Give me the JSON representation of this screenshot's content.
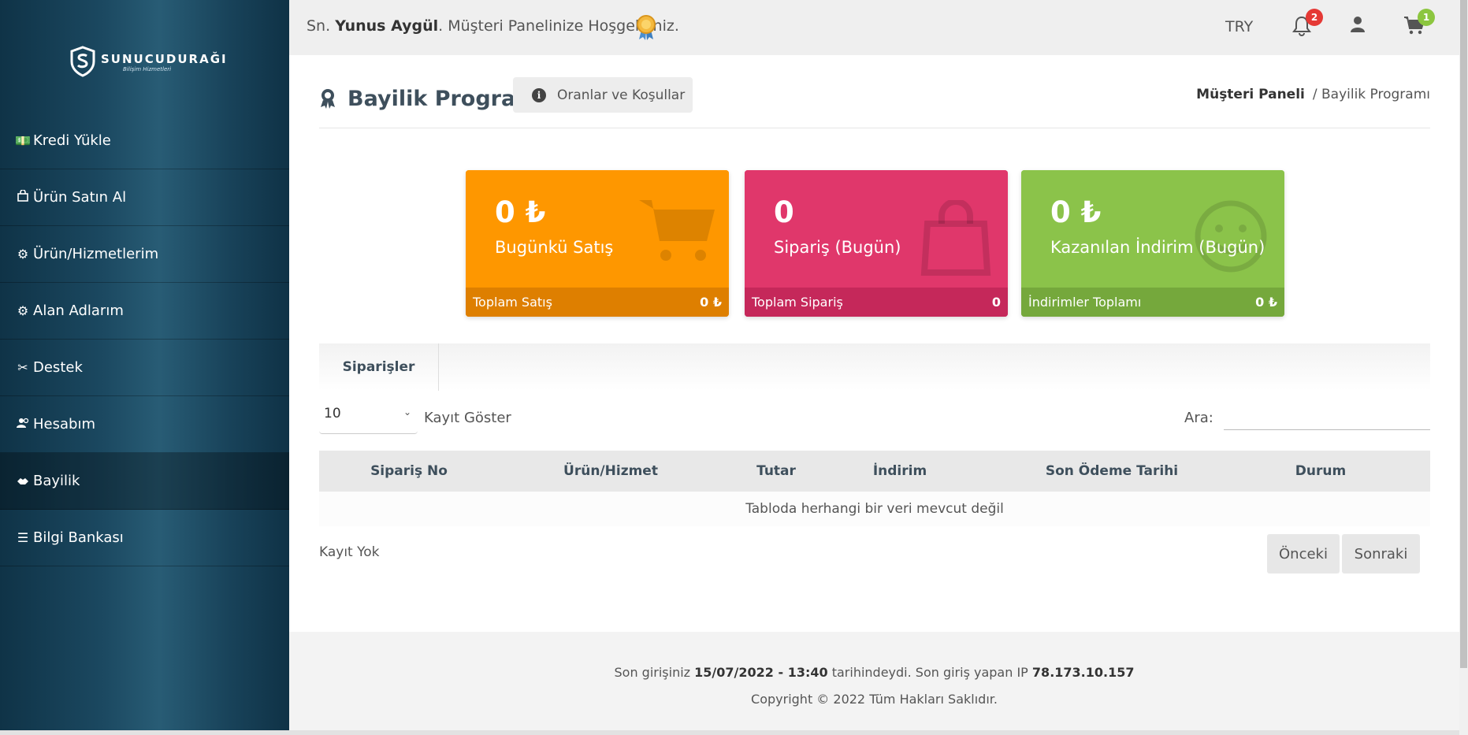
{
  "brand": {
    "name": "SUNUCUDURAĞI",
    "tagline": "Bilişim Hizmetleri"
  },
  "sidebar": {
    "items": [
      {
        "label": "Kredi Yükle",
        "icon": "money-icon"
      },
      {
        "label": "Ürün Satın Al",
        "icon": "shopping-bag-icon"
      },
      {
        "label": "Ürün/Hizmetlerim",
        "icon": "gear-icon"
      },
      {
        "label": "Alan Adlarım",
        "icon": "gear-icon"
      },
      {
        "label": "Destek",
        "icon": "tools-icon"
      },
      {
        "label": "Hesabım",
        "icon": "users-icon"
      },
      {
        "label": "Bayilik",
        "icon": "handshake-icon",
        "active": true
      },
      {
        "label": "Bilgi Bankası",
        "icon": "list-icon"
      }
    ]
  },
  "topbar": {
    "prefix": "Sn. ",
    "user_name": "Yunus Aygül",
    "welcome_suffix": ". Müşteri Panelinize Hoşgeldiniz.",
    "currency": "TRY",
    "notifications_count": "2",
    "cart_count": "1"
  },
  "page": {
    "title": "Bayilik Programı",
    "rates_button": "Oranlar ve Koşullar",
    "breadcrumb_home": "Müşteri Paneli",
    "breadcrumb_current": "/ Bayilik Programı"
  },
  "cards": [
    {
      "value": "0 ₺",
      "label": "Bugünkü Satış",
      "foot_label": "Toplam Satış",
      "foot_value": "0 ₺",
      "color": "#fe9700",
      "foot_color": "#de7f00"
    },
    {
      "value": "0",
      "label": "Sipariş (Bugün)",
      "foot_label": "Toplam Sipariş",
      "foot_value": "0",
      "color": "#e0376b",
      "foot_color": "#c5285a"
    },
    {
      "value": "0 ₺",
      "label": "Kazanılan İndirim (Bugün)",
      "foot_label": "İndirimler Toplamı",
      "foot_value": "0 ₺",
      "color": "#8bc34a",
      "foot_color": "#75a83c"
    }
  ],
  "tabs": [
    "Siparişler"
  ],
  "table": {
    "length_value": "10",
    "length_label": "Kayıt Göster",
    "search_label": "Ara:",
    "columns": [
      "Sipariş No",
      "Ürün/Hizmet",
      "Tutar",
      "İndirim",
      "Son Ödeme Tarihi",
      "Durum"
    ],
    "empty_message": "Tabloda herhangi bir veri mevcut değil",
    "info": "Kayıt Yok",
    "prev": "Önceki",
    "next": "Sonraki"
  },
  "footer": {
    "last_login_prefix": "Son girişiniz ",
    "last_login_date": "15/07/2022 - 13:40",
    "last_login_mid": " tarihindeydi. Son giriş yapan IP ",
    "last_login_ip": "78.173.10.157",
    "copyright": "Copyright © 2022 Tüm Hakları Saklıdır."
  }
}
